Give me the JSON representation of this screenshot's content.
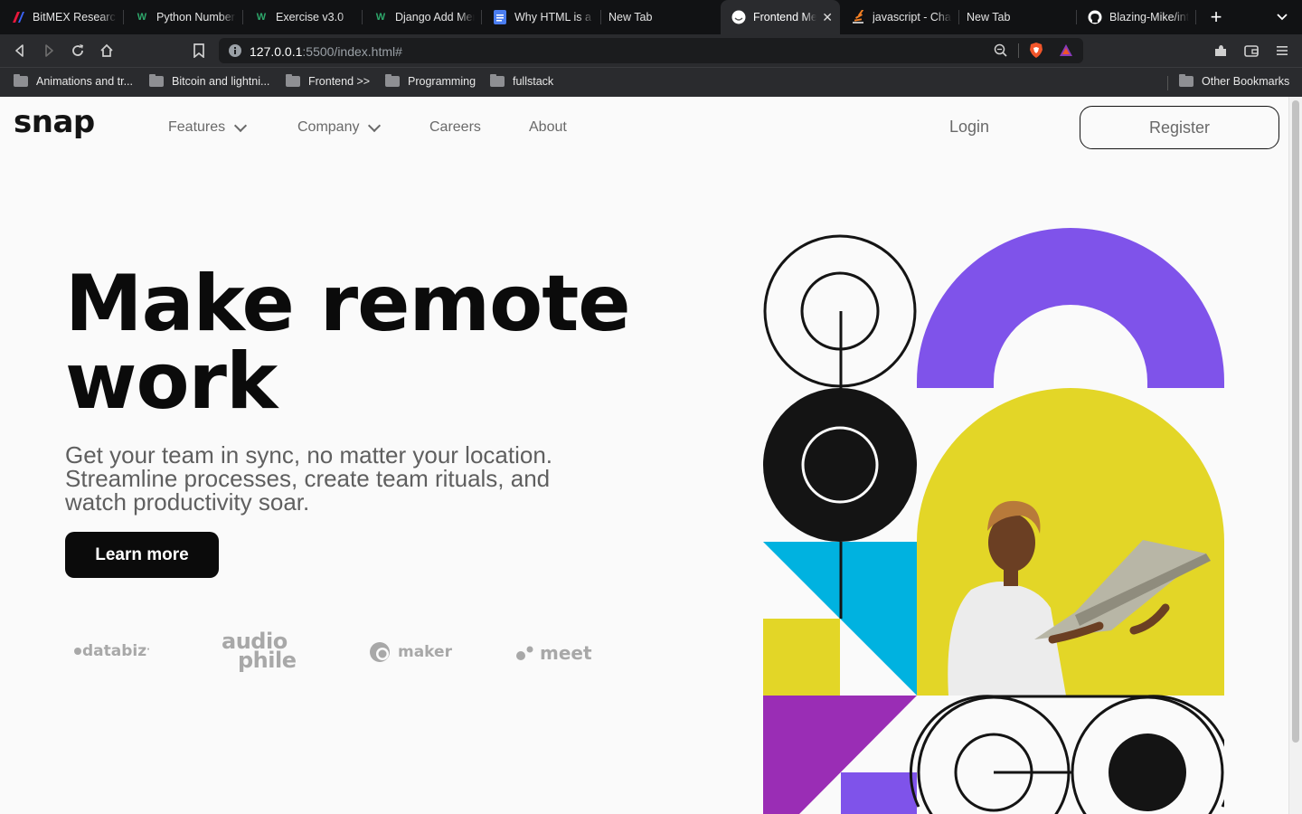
{
  "browser": {
    "tabs": [
      {
        "title": "BitMEX Research",
        "icon": "bitmex-icon"
      },
      {
        "title": "Python Numbers",
        "icon": "w3schools-icon"
      },
      {
        "title": "Exercise v3.0",
        "icon": "w3schools-icon"
      },
      {
        "title": "Django Add Mem",
        "icon": "w3schools-icon"
      },
      {
        "title": "Why HTML is a n",
        "icon": "docs-icon"
      },
      {
        "title": "New Tab",
        "icon": ""
      },
      {
        "title": "Frontend Me",
        "icon": "frontend-mentor-icon",
        "active": true
      },
      {
        "title": "javascript - Chan",
        "icon": "stackoverflow-icon"
      },
      {
        "title": "New Tab",
        "icon": ""
      },
      {
        "title": "Blazing-Mike/intr",
        "icon": "github-icon"
      }
    ],
    "new_tab_label": "+",
    "url_host": "127.0.0.1",
    "url_rest": ":5500/index.html#",
    "bookmarks": [
      "Animations and tr...",
      "Bitcoin and lightni...",
      "Frontend >>",
      "Programming",
      "fullstack"
    ],
    "other_bookmarks": "Other Bookmarks"
  },
  "site": {
    "logo": "snap",
    "nav": {
      "features": "Features",
      "company": "Company",
      "careers": "Careers",
      "about": "About"
    },
    "login": "Login",
    "register": "Register",
    "hero": {
      "title_line1": "Make remote",
      "title_line2": "work",
      "subtitle": "Get your team in sync, no matter your location. Streamline processes, create team rituals, and watch productivity soar.",
      "cta": "Learn more"
    },
    "clients": {
      "databiz": "databiz",
      "audiophile_top": "audio",
      "audiophile_bottom": "phile",
      "maker": "maker",
      "meet": "meet"
    }
  },
  "colors": {
    "purple": "#7f53ea",
    "yellow": "#e3d627",
    "cyan": "#00b2e0",
    "magenta": "#9a2db5",
    "black": "#141414"
  }
}
